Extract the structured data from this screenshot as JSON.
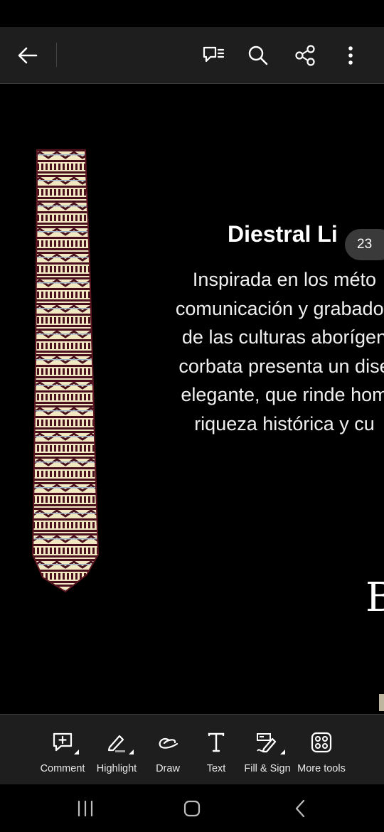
{
  "toolbar_top": {
    "back_icon": "arrow-left-icon",
    "comment_list_icon": "comment-list-icon",
    "search_icon": "search-icon",
    "share_icon": "share-icon",
    "more_icon": "more-vertical-icon"
  },
  "document": {
    "title": "Diestral Li",
    "body_lines": [
      "Inspirada en los méto",
      "comunicación y grabados",
      "de las culturas aborígen",
      "corbata presenta un dise",
      "elegante, que rinde hom",
      "riqueza histórica y cu"
    ],
    "page_number": "23",
    "partial_letter": "B",
    "image": "patterned-tie"
  },
  "bottom_tools": [
    {
      "label": "Comment",
      "icon": "comment-add-icon"
    },
    {
      "label": "Highlight",
      "icon": "highlight-icon"
    },
    {
      "label": "Draw",
      "icon": "draw-icon"
    },
    {
      "label": "Text",
      "icon": "text-icon"
    },
    {
      "label": "Fill & Sign",
      "icon": "fill-sign-icon"
    },
    {
      "label": "More tools",
      "icon": "more-tools-icon"
    }
  ],
  "nav": {
    "recents_icon": "recent-apps-icon",
    "home_icon": "home-icon",
    "back_icon": "nav-back-icon"
  },
  "colors": {
    "bar_bg": "#1e1e1e",
    "page_bg": "#000000",
    "badge_bg": "#3a3a3a",
    "tie_maroon": "#4a0f1c",
    "tie_cream": "#f1e8c2"
  }
}
